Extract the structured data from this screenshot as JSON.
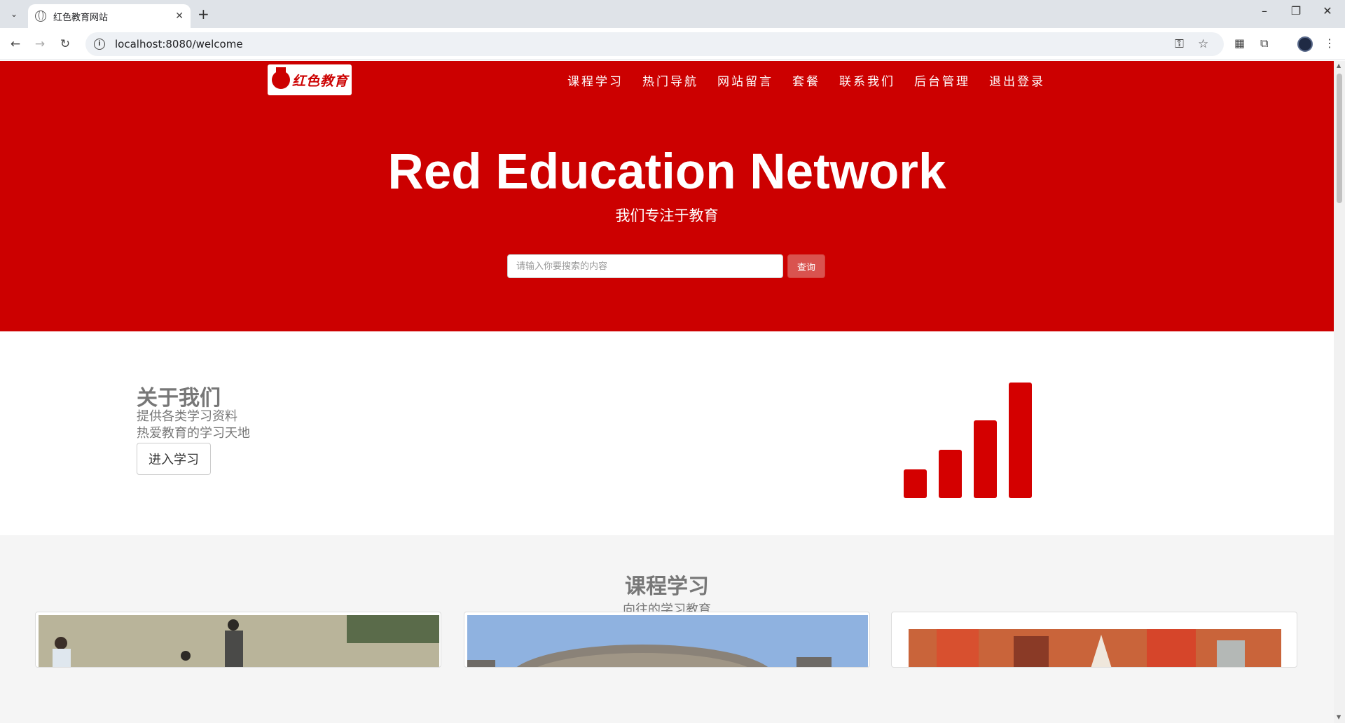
{
  "browser": {
    "tab_title": "红色教育网站",
    "url": "localhost:8080/welcome"
  },
  "header": {
    "logo_text": "红色教育",
    "menu": [
      {
        "label": "课程学习"
      },
      {
        "label": "热门导航"
      },
      {
        "label": "网站留言"
      },
      {
        "label": "套餐"
      },
      {
        "label": "联系我们"
      },
      {
        "label": "后台管理"
      },
      {
        "label": "退出登录"
      }
    ]
  },
  "hero": {
    "title": "Red Education Network",
    "subtitle": "我们专注于教育",
    "search_placeholder": "请输入你要搜索的内容",
    "search_button": "查询"
  },
  "about": {
    "title": "关于我们",
    "lines": [
      "提供各类学习资料",
      "热爱教育的学习天地"
    ],
    "button": "进入学习",
    "icon": "signal-bars-icon",
    "bar_levels": [
      0.25,
      0.42,
      0.67,
      1.0
    ],
    "bar_color": "#d40000"
  },
  "courses": {
    "title": "课程学习",
    "subtitle": "向往的学习教育"
  },
  "colors": {
    "brand_red": "#cc0000",
    "search_button": "#d9534f"
  }
}
